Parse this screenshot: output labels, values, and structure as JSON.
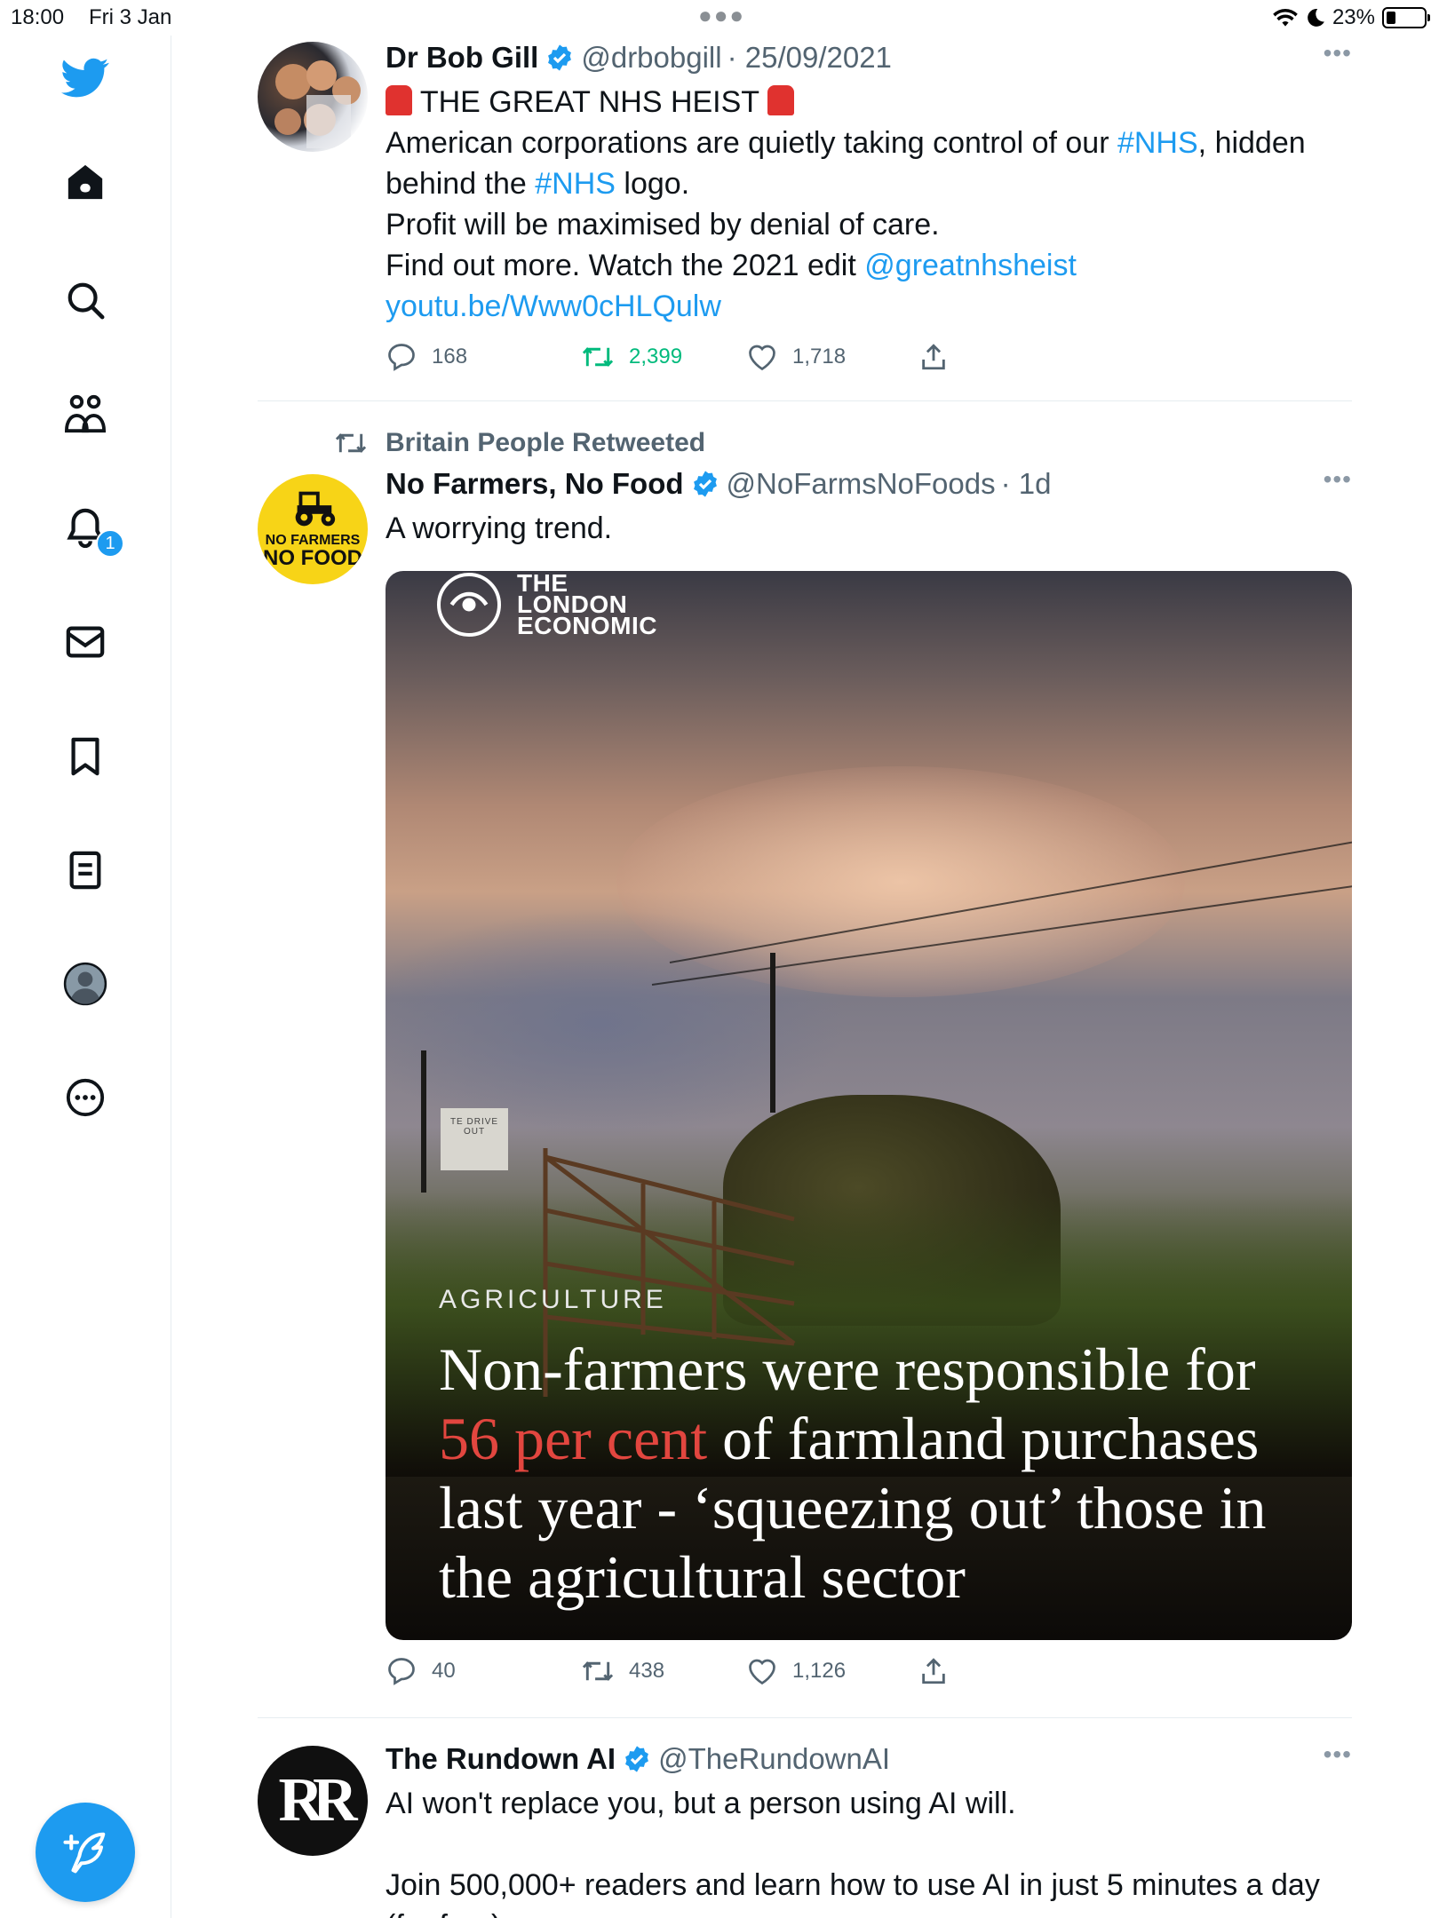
{
  "status_bar": {
    "time": "18:00",
    "date": "Fri 3 Jan",
    "battery": "23%",
    "battery_level": 0.23
  },
  "sidebar": {
    "notification_count": "1",
    "items": [
      {
        "icon": "twitter-bird-icon"
      },
      {
        "icon": "home-icon"
      },
      {
        "icon": "search-icon"
      },
      {
        "icon": "communities-icon"
      },
      {
        "icon": "notifications-bell-icon"
      },
      {
        "icon": "messages-envelope-icon"
      },
      {
        "icon": "bookmark-icon"
      },
      {
        "icon": "lists-icon"
      },
      {
        "icon": "profile-avatar-icon"
      },
      {
        "icon": "more-circle-icon"
      }
    ],
    "compose_icon": "compose-feather-icon"
  },
  "tweets": [
    {
      "name": "Dr Bob Gill",
      "handle": "@drbobgill",
      "date": "· 25/09/2021",
      "line1": "THE GREAT NHS HEIST",
      "line2_pre": "American corporations are quietly taking control of our ",
      "line2_tag": "#NHS",
      "line2_post": ", hidden",
      "line3_pre": "behind the ",
      "line3_tag": "#NHS",
      "line3_post": " logo.",
      "line4": "Profit will be maximised by denial of care.",
      "line5_pre": "Find out more. Watch the 2021 edit ",
      "line5_mention": "@greatnhsheist",
      "line6_link": "youtu.be/Www0cHLQulw",
      "replies": "168",
      "retweets": "2,399",
      "likes": "1,718"
    },
    {
      "retweeted_by": "Britain People Retweeted",
      "name": "No Farmers, No Food",
      "handle": "@NoFarmsNoFoods",
      "date": "· 1d",
      "text": "A worrying trend.",
      "avatar_line1": "NO FARMERS",
      "avatar_line2": "NO FOOD",
      "media": {
        "logo_line1": "THE",
        "logo_line2": "LONDON",
        "logo_line3": "ECONOMIC",
        "category": "AGRICULTURE",
        "headline_pre": "Non-farmers were responsible for ",
        "headline_highlight": "56 per cent",
        "headline_post": " of farmland purchases last year - ‘squeezing out’ those in the agricultural sector",
        "sign_text": "TE DRIVE OUT"
      },
      "replies": "40",
      "retweets": "438",
      "likes": "1,126"
    },
    {
      "name": "The Rundown AI",
      "handle": "@TheRundownAI",
      "avatar_text": "RR",
      "line1": "AI won't replace you, but a person using AI will.",
      "line2": "Join 500,000+ readers and learn how to use AI in just 5 minutes a day",
      "line3": "(for free)."
    }
  ],
  "colors": {
    "accent": "#1d9bf0",
    "retweet_active": "#00ba7c",
    "muted": "#536471",
    "headline_red": "#e2463f"
  }
}
